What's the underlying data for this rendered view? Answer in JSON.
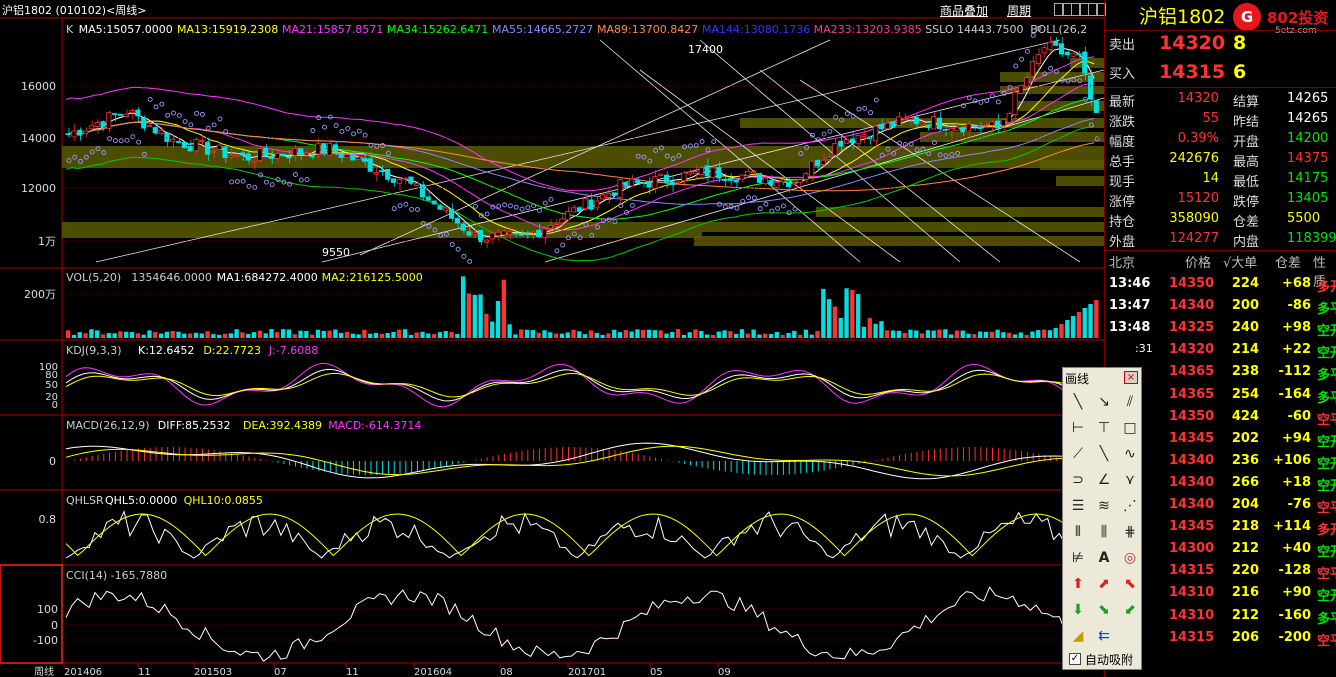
{
  "window": {
    "title": "沪铝1802 (010102)<周线>",
    "link_overlay": "商品叠加",
    "link_period": "周期",
    "nav_buttons": [
      "◀",
      "▶",
      "▲",
      "▼",
      "■",
      "×"
    ]
  },
  "main_panel": {
    "legend": [
      {
        "text": "K",
        "color": "#cccccc"
      },
      {
        "text": "MA5:15057.0000",
        "color": "#ffffff"
      },
      {
        "text": "MA13:15919.2308",
        "color": "#ffff00"
      },
      {
        "text": "MA21:15857.8571",
        "color": "#ff33ff"
      },
      {
        "text": "MA34:15262.6471",
        "color": "#00ff00"
      },
      {
        "text": "MA55:14665.2727",
        "color": "#8888ff"
      },
      {
        "text": "MA89:13700.8427",
        "color": "#ff8844"
      },
      {
        "text": "MA144:13080.1736",
        "color": "#3333ff"
      },
      {
        "text": "MA233:13203.9385",
        "color": "#ff3399"
      },
      {
        "text": "SSLO 14443.7500",
        "color": "#cccccc"
      },
      {
        "text": "BOLL(26,2",
        "color": "#cccccc"
      }
    ],
    "y_labels": [
      "16000",
      "14000",
      "12000",
      "1万"
    ],
    "annotations": {
      "high": "17400",
      "low": "9550"
    }
  },
  "volume_panel": {
    "legend": [
      {
        "text": "VOL(5,20)",
        "color": "#cccccc"
      },
      {
        "text": "1354646.0000",
        "color": "#cccccc"
      },
      {
        "text": "MA1:684272.4000",
        "color": "#ffffff"
      },
      {
        "text": "MA2:216125.5000",
        "color": "#ffff00"
      }
    ],
    "y_label": "200万"
  },
  "kdj_panel": {
    "legend": [
      {
        "text": "KDJ(9,3,3)",
        "color": "#cccccc"
      },
      {
        "text": "K:12.6452",
        "color": "#ffffff"
      },
      {
        "text": "D:22.7723",
        "color": "#ffff00"
      },
      {
        "text": "J:-7.6088",
        "color": "#ff33ff"
      }
    ],
    "y_labels": [
      "100",
      "80",
      "50",
      "20",
      "0"
    ]
  },
  "macd_panel": {
    "legend": [
      {
        "text": "MACD(26,12,9)",
        "color": "#cccccc"
      },
      {
        "text": "DIFF:85.2532",
        "color": "#ffffff"
      },
      {
        "text": "DEA:392.4389",
        "color": "#ffff00"
      },
      {
        "text": "MACD:-614.3714",
        "color": "#ff33ff"
      }
    ],
    "y_label": "0"
  },
  "qhlsr_panel": {
    "legend": [
      {
        "text": "QHLSR",
        "color": "#cccccc"
      },
      {
        "text": "QHL5:0.0000",
        "color": "#ffffff"
      },
      {
        "text": "QHL10:0.0855",
        "color": "#ffff00"
      }
    ],
    "y_label": "0.8"
  },
  "cci_panel": {
    "legend": [
      {
        "text": "CCI(14)  -165.7880",
        "color": "#cccccc"
      }
    ],
    "y_labels": [
      "100",
      "0",
      "-100"
    ]
  },
  "x_axis": {
    "period": "周线",
    "labels": [
      "201406",
      "11",
      "201503",
      "07",
      "11",
      "201604",
      "08",
      "201701",
      "05",
      "09"
    ]
  },
  "quote": {
    "name": "沪铝1802",
    "name_suffix": "(",
    "logo_text": "802投资",
    "logo_sub": "5etz.com",
    "ask_label": "卖出",
    "ask_price": "14320",
    "ask_vol": "8",
    "bid_label": "买入",
    "bid_price": "14315",
    "bid_vol": "6",
    "rows": [
      {
        "l1": "最新",
        "v1": "14320",
        "c1": "red",
        "l2": "结算",
        "v2": "14265",
        "c2": "wht"
      },
      {
        "l1": "涨跌",
        "v1": "55",
        "c1": "red",
        "l2": "昨结",
        "v2": "14265",
        "c2": "wht"
      },
      {
        "l1": "幅度",
        "v1": "0.39%",
        "c1": "red",
        "l2": "开盘",
        "v2": "14200",
        "c2": "grn"
      },
      {
        "l1": "总手",
        "v1": "242676",
        "c1": "yel",
        "l2": "最高",
        "v2": "14375",
        "c2": "red"
      },
      {
        "l1": "现手",
        "v1": "14",
        "c1": "yel",
        "l2": "最低",
        "v2": "14175",
        "c2": "grn"
      },
      {
        "l1": "涨停",
        "v1": "15120",
        "c1": "red",
        "l2": "跌停",
        "v2": "13405",
        "c2": "grn"
      },
      {
        "l1": "持仓",
        "v1": "358090",
        "c1": "yel",
        "l2": "仓差",
        "v2": "5500",
        "c2": "yel"
      },
      {
        "l1": "外盘",
        "v1": "124277",
        "c1": "red",
        "l2": "内盘",
        "v2": "118399",
        "c2": "grn"
      }
    ]
  },
  "ticks": {
    "headers": [
      "北京",
      "价格",
      "√大单",
      "仓差",
      "性质"
    ],
    "rows": [
      {
        "t": "13:46",
        "p": "14350",
        "v": "224",
        "d": "+68",
        "k": "多开",
        "kc": "red"
      },
      {
        "t": "13:47",
        "p": "14340",
        "v": "200",
        "d": "-86",
        "k": "多平",
        "kc": "grn"
      },
      {
        "t": "13:48",
        "p": "14325",
        "v": "240",
        "d": "+98",
        "k": "空开",
        "kc": "grn"
      },
      {
        "t": ":31",
        "p": "14320",
        "v": "214",
        "d": "+22",
        "k": "空开",
        "kc": "grn"
      },
      {
        "t": "",
        "p": "14365",
        "v": "238",
        "d": "-112",
        "k": "多平",
        "kc": "grn"
      },
      {
        "t": "",
        "p": "14365",
        "v": "254",
        "d": "-164",
        "k": "多平",
        "kc": "grn"
      },
      {
        "t": "",
        "p": "14350",
        "v": "424",
        "d": "-60",
        "k": "空平",
        "kc": "red"
      },
      {
        "t": "",
        "p": "14345",
        "v": "202",
        "d": "+94",
        "k": "空开",
        "kc": "grn"
      },
      {
        "t": "",
        "p": "14340",
        "v": "236",
        "d": "+106",
        "k": "空开",
        "kc": "grn"
      },
      {
        "t": "",
        "p": "14340",
        "v": "266",
        "d": "+18",
        "k": "空开",
        "kc": "grn"
      },
      {
        "t": "",
        "p": "14340",
        "v": "204",
        "d": "-76",
        "k": "空平",
        "kc": "red"
      },
      {
        "t": "",
        "p": "14345",
        "v": "218",
        "d": "+114",
        "k": "多开",
        "kc": "red"
      },
      {
        "t": "",
        "p": "14300",
        "v": "212",
        "d": "+40",
        "k": "空开",
        "kc": "grn"
      },
      {
        "t": "",
        "p": "14315",
        "v": "220",
        "d": "-128",
        "k": "空平",
        "kc": "red"
      },
      {
        "t": "",
        "p": "14310",
        "v": "216",
        "d": "+90",
        "k": "空开",
        "kc": "grn"
      },
      {
        "t": "",
        "p": "14310",
        "v": "212",
        "d": "-160",
        "k": "多平",
        "kc": "grn"
      },
      {
        "t": "",
        "p": "14315",
        "v": "206",
        "d": "-200",
        "k": "空平",
        "kc": "red"
      }
    ]
  },
  "draw_tool": {
    "title": "画线",
    "close": "×",
    "auto_snap_label": "自动吸附",
    "auto_snap_checked": true,
    "text_tool_label": "A",
    "tools": [
      "line-segment-icon",
      "arrow-line-icon",
      "parallel-lines-icon",
      "horizontal-line-icon",
      "vertical-line-icon",
      "rectangle-icon",
      "ray-icon",
      "trend-line-icon",
      "wave-icon",
      "arc-icon",
      "angle-line-icon",
      "fan-icon",
      "channel-icon",
      "regression-icon",
      "speed-lines-icon",
      "cycle-lines-icon",
      "fibonacci-icon",
      "gann-icon",
      "gann-box-icon",
      "text-icon",
      "circle-icon",
      "up-arrow-icon",
      "up-right-arrow-icon",
      "up-left-arrow-icon",
      "down-arrow-icon",
      "down-right-arrow-icon",
      "down-left-arrow-icon",
      "eraser-icon",
      "delete-icon"
    ]
  }
}
